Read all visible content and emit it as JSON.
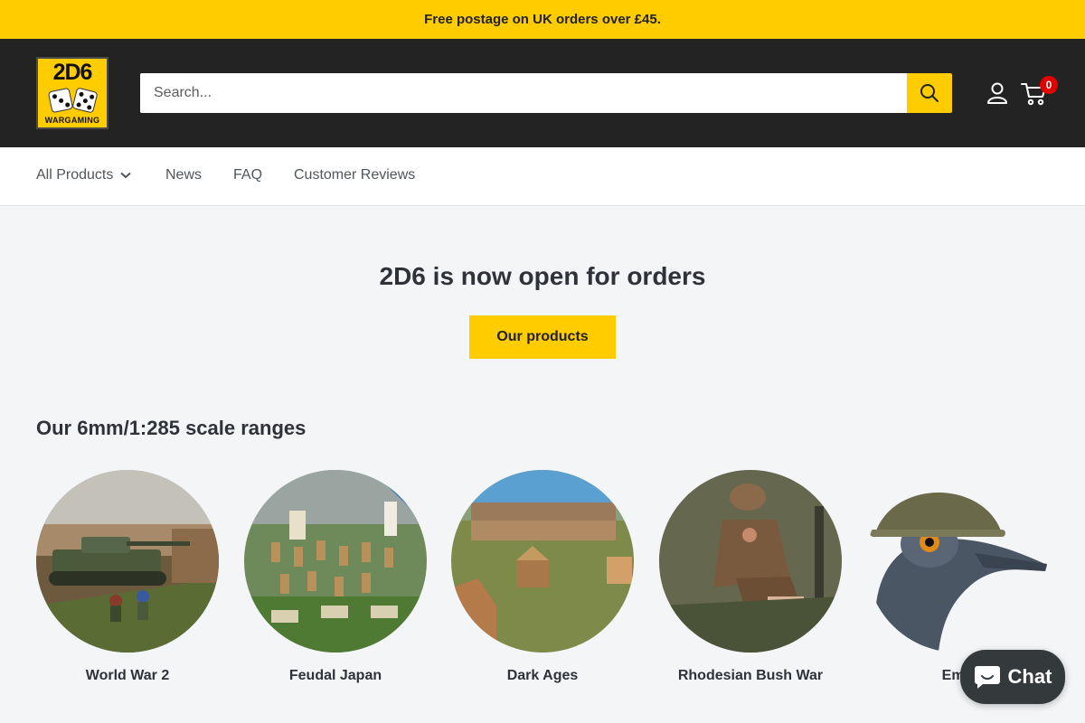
{
  "announcement": "Free postage on UK orders over £45.",
  "logo": {
    "top_text": "2D6",
    "bottom_text": "WARGAMING"
  },
  "search": {
    "placeholder": "Search..."
  },
  "cart": {
    "count": "0"
  },
  "nav": {
    "items": [
      "All Products",
      "News",
      "FAQ",
      "Customer Reviews"
    ]
  },
  "hero": {
    "title": "2D6 is now open for orders",
    "button": "Our products"
  },
  "ranges": {
    "title": "Our 6mm/1:285 scale ranges",
    "items": [
      "World War 2",
      "Feudal Japan",
      "Dark Ages",
      "Rhodesian Bush War",
      "Emu"
    ]
  },
  "chat": {
    "label": "Chat"
  },
  "colors": {
    "accent": "#ffcc00",
    "header": "#232323",
    "badge": "#e00000"
  }
}
